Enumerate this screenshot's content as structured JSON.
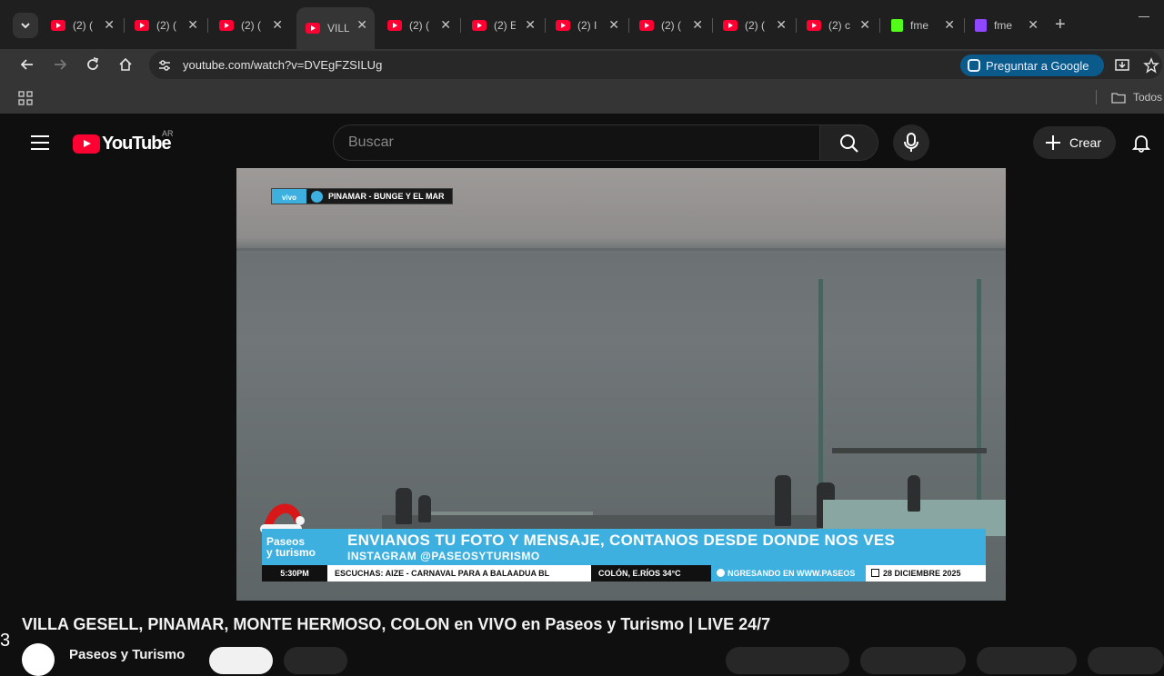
{
  "browser": {
    "tabs": [
      {
        "title": "(2) (",
        "icon": "youtube-icon"
      },
      {
        "title": "(2) (",
        "icon": "youtube-icon"
      },
      {
        "title": "(2) (",
        "icon": "youtube-icon"
      },
      {
        "title": "VILL",
        "icon": "youtube-icon",
        "active": true
      },
      {
        "title": "(2) (",
        "icon": "youtube-icon"
      },
      {
        "title": "(2) E",
        "icon": "youtube-icon"
      },
      {
        "title": "(2) I",
        "icon": "youtube-icon"
      },
      {
        "title": "(2) (",
        "icon": "youtube-icon"
      },
      {
        "title": "(2) (",
        "icon": "youtube-icon"
      },
      {
        "title": "(2) c",
        "icon": "youtube-icon"
      },
      {
        "title": "fme",
        "icon": "kick-icon"
      },
      {
        "title": "fme",
        "icon": "twitch-icon"
      }
    ],
    "url": "youtube.com/watch?v=DVEgFZSILUg",
    "ask_google": "Preguntar a Google",
    "bookmark_folder": "Todos"
  },
  "youtube": {
    "logo_text": "YouTube",
    "country": "AR",
    "search_placeholder": "Buscar",
    "create_label": "Crear"
  },
  "video": {
    "live_badge": "vivo",
    "location": "PINAMAR - BUNGE Y EL MAR",
    "overlay_logo": [
      "Paseos",
      "y turismo"
    ],
    "headline": "ENVIANOS TU FOTO Y MENSAJE, CONTANOS DESDE DONDE NOS VES",
    "subline": "INSTAGRAM @PASEOSYTURISMO",
    "time": "5:30PM",
    "ticker": "ESCUCHAS:  AIZE - CARNAVAL PARA A BALAADUA BL",
    "weather": "COLÓN, E.RÍOS  34°C",
    "web": "NGRESANDO EN WWW.PASEOS",
    "date": "28 DICIEMBRE 2025"
  },
  "page": {
    "title": "VILLA GESELL, PINAMAR, MONTE HERMOSO, COLON en VIVO en Paseos y Turismo | LIVE 24/7",
    "channel_name": "Paseos y Turismo",
    "left_edge_char": "3"
  },
  "colors": {
    "accent": "#3db0e0",
    "youtube_red": "#ff0033",
    "ask_google_bg": "#0b5a8c"
  }
}
